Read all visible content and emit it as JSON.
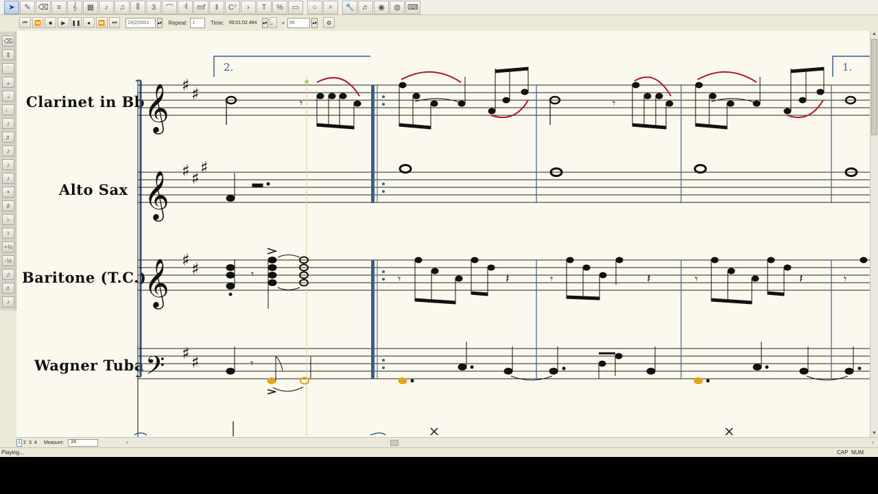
{
  "toolbar": {
    "buttons": [
      "select-arrow",
      "pencil",
      "eraser",
      "staff-tool",
      "clef",
      "measure",
      "quarter-note",
      "eighth-note",
      "chord",
      "triplet",
      "slur",
      "repeat",
      "dynamics-mf",
      "barline",
      "chord-symbol",
      "articulation",
      "text-T",
      "percent",
      "page",
      "circle-tool",
      "zoom",
      "wrench",
      "midi",
      "sound",
      "soundfont",
      "playback-keys"
    ]
  },
  "playback": {
    "position": "24|2|0301",
    "repeat_label": "Repeat:",
    "repeat_value": "1",
    "time_label": "Time:",
    "time_value": "00:01:02.484",
    "tempo_value": "96"
  },
  "score": {
    "instruments": [
      "Clarinet in Bb",
      "Alto Sax",
      "Baritone (T.C.)",
      "Wagner Tuba"
    ],
    "ending_2": "2.",
    "ending_1": "1."
  },
  "bottombar": {
    "pages": [
      "1",
      "2",
      "3",
      "4"
    ],
    "measure_label": "Measure:",
    "measure_value": "24"
  },
  "status": {
    "text": "Playing...",
    "cap": "CAP",
    "num": "NUM"
  },
  "colors": {
    "score_bg": "#fbf9ee",
    "barline_blue": "#3b5e91",
    "slur_red": "#b3122f",
    "highlight_gold": "#e1a51d"
  }
}
